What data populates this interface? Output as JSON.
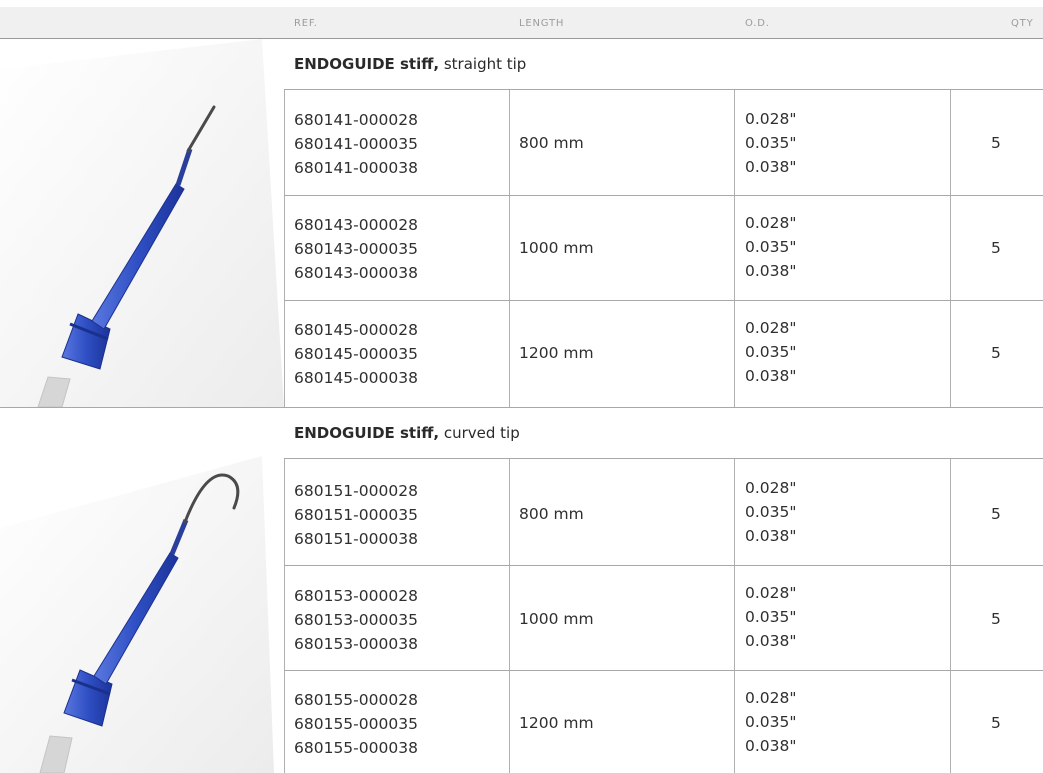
{
  "header": {
    "ref": "REF.",
    "length": "LENGTH",
    "od": "O.D.",
    "qty": "QTY"
  },
  "products": [
    {
      "brand": "ENDOGUIDE stiff,",
      "variant": " straight tip",
      "image_icon": "straight-tip-guidewire",
      "rows": [
        {
          "refs": [
            "680141-000028",
            "680141-000035",
            "680141-000038"
          ],
          "length": "800 mm",
          "od": [
            "0.028\"",
            "0.035\"",
            "0.038\""
          ],
          "qty": "5"
        },
        {
          "refs": [
            "680143-000028",
            "680143-000035",
            "680143-000038"
          ],
          "length": "1000 mm",
          "od": [
            "0.028\"",
            "0.035\"",
            "0.038\""
          ],
          "qty": "5"
        },
        {
          "refs": [
            "680145-000028",
            "680145-000035",
            "680145-000038"
          ],
          "length": "1200 mm",
          "od": [
            "0.028\"",
            "0.035\"",
            "0.038\""
          ],
          "qty": "5"
        }
      ]
    },
    {
      "brand": "ENDOGUIDE stiff,",
      "variant": " curved tip",
      "image_icon": "curved-tip-guidewire",
      "rows": [
        {
          "refs": [
            "680151-000028",
            "680151-000035",
            "680151-000038"
          ],
          "length": "800 mm",
          "od": [
            "0.028\"",
            "0.035\"",
            "0.038\""
          ],
          "qty": "5"
        },
        {
          "refs": [
            "680153-000028",
            "680153-000035",
            "680153-000038"
          ],
          "length": "1000 mm",
          "od": [
            "0.028\"",
            "0.035\"",
            "0.038\""
          ],
          "qty": "5"
        },
        {
          "refs": [
            "680155-000028",
            "680155-000035",
            "680155-000038"
          ],
          "length": "1200 mm",
          "od": [
            "0.028\"",
            "0.035\"",
            "0.038\""
          ],
          "qty": "5"
        }
      ]
    }
  ],
  "colors": {
    "header_bg": "#f0f0f0",
    "handle_blue": "#2f4fc4",
    "rule": "#a8a8a8"
  }
}
